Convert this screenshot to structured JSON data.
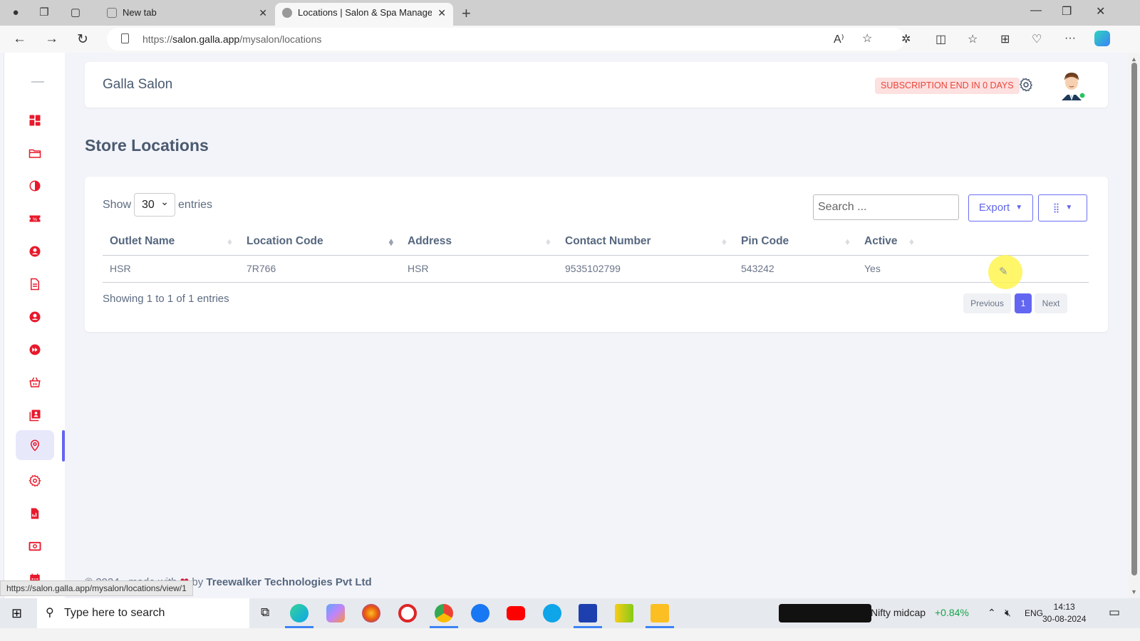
{
  "browser": {
    "tabs": [
      {
        "title": "New tab",
        "active": false
      },
      {
        "title": "Locations | Salon & Spa Management",
        "active": true
      }
    ],
    "url_prefix": "https://",
    "url_host": "salon.galla.app",
    "url_path": "/mysalon/locations",
    "status_url": "https://salon.galla.app/mysalon/locations/view/1"
  },
  "header": {
    "brand": "Galla Salon",
    "subscription_badge": "SUBSCRIPTION END IN 0 DAYS"
  },
  "sidebar": {
    "items": [
      {
        "icon": "dashboard-icon"
      },
      {
        "icon": "folder-icon"
      },
      {
        "icon": "contrast-icon"
      },
      {
        "icon": "discount-ticket-icon"
      },
      {
        "icon": "user-circle-icon"
      },
      {
        "icon": "document-icon"
      },
      {
        "icon": "user-circle-icon"
      },
      {
        "icon": "fast-forward-icon"
      },
      {
        "icon": "basket-icon"
      },
      {
        "icon": "contacts-icon"
      },
      {
        "icon": "location-pin-icon",
        "active": true
      },
      {
        "icon": "settings-icon"
      },
      {
        "icon": "report-icon"
      },
      {
        "icon": "cash-icon"
      },
      {
        "icon": "calendar-icon"
      }
    ],
    "icon_color": "#e8192c",
    "active_color": "#6366f1"
  },
  "main": {
    "title": "Store Locations",
    "show_label": "Show",
    "entries_label": "entries",
    "page_length": "30",
    "search_placeholder": "Search ...",
    "export_label": "Export",
    "table": {
      "columns": [
        "Outlet Name",
        "Location Code",
        "Address",
        "Contact Number",
        "Pin Code",
        "Active",
        ""
      ],
      "rows": [
        {
          "outlet_name": "HSR",
          "location_code": "7R766",
          "address": "HSR",
          "contact_number": "9535102799",
          "pin_code": "543242",
          "active": "Yes"
        }
      ]
    },
    "info": "Showing 1 to 1 of 1 entries",
    "pagination": {
      "previous": "Previous",
      "current": "1",
      "next": "Next"
    }
  },
  "footer": {
    "prefix": "© 2024 , made with",
    "by": "by",
    "company": "Treewalker Technologies Pvt Ltd"
  },
  "taskbar": {
    "search_placeholder": "Type here to search",
    "ticker_name": "Nifty midcap",
    "ticker_change": "+0.84%",
    "language": "ENG",
    "time": "14:13",
    "date": "30-08-2024"
  }
}
